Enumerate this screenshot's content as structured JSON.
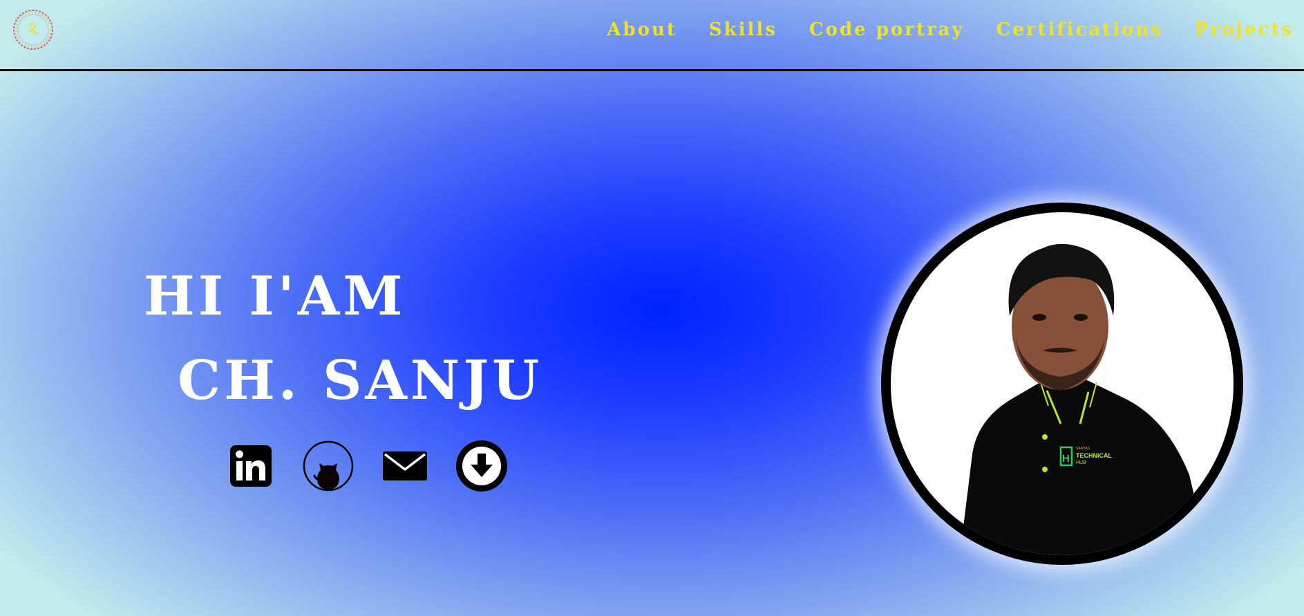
{
  "nav": {
    "items": [
      {
        "label": "About"
      },
      {
        "label": "Skills"
      },
      {
        "label": "Code portray"
      },
      {
        "label": "Certifications"
      },
      {
        "label": "Projects"
      }
    ]
  },
  "hero": {
    "line1": "HI I'AM",
    "line2": "CH. SANJU"
  },
  "social": {
    "icons": [
      "linkedin-icon",
      "github-icon",
      "mail-icon",
      "download-icon"
    ]
  },
  "portrait": {
    "shirt_logo": {
      "small": "SANYAS",
      "line1": "TECHNICAL",
      "line2": "HUB",
      "mark": "H"
    }
  },
  "colors": {
    "nav_text": "#f0e22a",
    "hero_text": "#ffffff",
    "center_blue": "#0022ff",
    "edge_cyan": "#c2ecec"
  }
}
